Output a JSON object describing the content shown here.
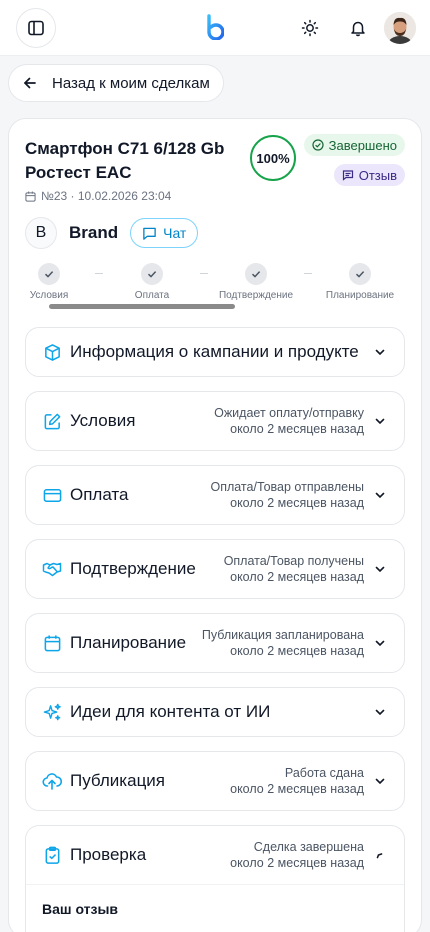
{
  "topbar": {
    "icons": [
      "sidebar-toggle-icon",
      "logo-icon",
      "sun-icon",
      "bell-icon",
      "user-avatar"
    ]
  },
  "back_button": {
    "label": "Назад к моим сделкам"
  },
  "deal": {
    "title": "Смартфон С71 6/128 Gb Ростест EAC",
    "meta": "№23 · 10.02.2026 23:04",
    "progress": "100%",
    "progress_value": 100,
    "status_badge": "Завершено",
    "review_badge": "Отзыв",
    "brand_letter": "B",
    "brand_name": "Brand",
    "chat_label": "Чат"
  },
  "steps": [
    {
      "label": "Условия"
    },
    {
      "label": "Оплата"
    },
    {
      "label": "Подтверждение"
    },
    {
      "label": "Планирование"
    }
  ],
  "sections": [
    {
      "name": "Информация о кампании и продукте",
      "icon": "box-icon",
      "status": "",
      "time": ""
    },
    {
      "name": "Условия",
      "icon": "edit-icon",
      "status": "Ожидает оплату/отправку",
      "time": "около 2 месяцев назад"
    },
    {
      "name": "Оплата",
      "icon": "credit-card-icon",
      "status": "Оплата/Товар отправлены",
      "time": "около 2 месяцев назад"
    },
    {
      "name": "Подтверждение",
      "icon": "handshake-icon",
      "status": "Оплата/Товар получены",
      "time": "около 2 месяцев назад"
    },
    {
      "name": "Планирование",
      "icon": "calendar-icon",
      "status": "Публикация запланирована",
      "time": "около 2 месяцев назад"
    },
    {
      "name": "Идеи для контента от ИИ",
      "icon": "sparkles-icon",
      "status": "",
      "time": ""
    },
    {
      "name": "Публикация",
      "icon": "cloud-upload-icon",
      "status": "Работа сдана",
      "time": "около 2 месяцев назад"
    }
  ],
  "review_section": {
    "name": "Проверка",
    "icon": "clipboard-check-icon",
    "status": "Сделка завершена",
    "time": "около 2 месяцев назад",
    "body_title": "Ваш отзыв"
  },
  "colors": {
    "accent": "#0ea5e9",
    "success": "#16a34a",
    "review_badge_bg": "#ebe6fb"
  }
}
